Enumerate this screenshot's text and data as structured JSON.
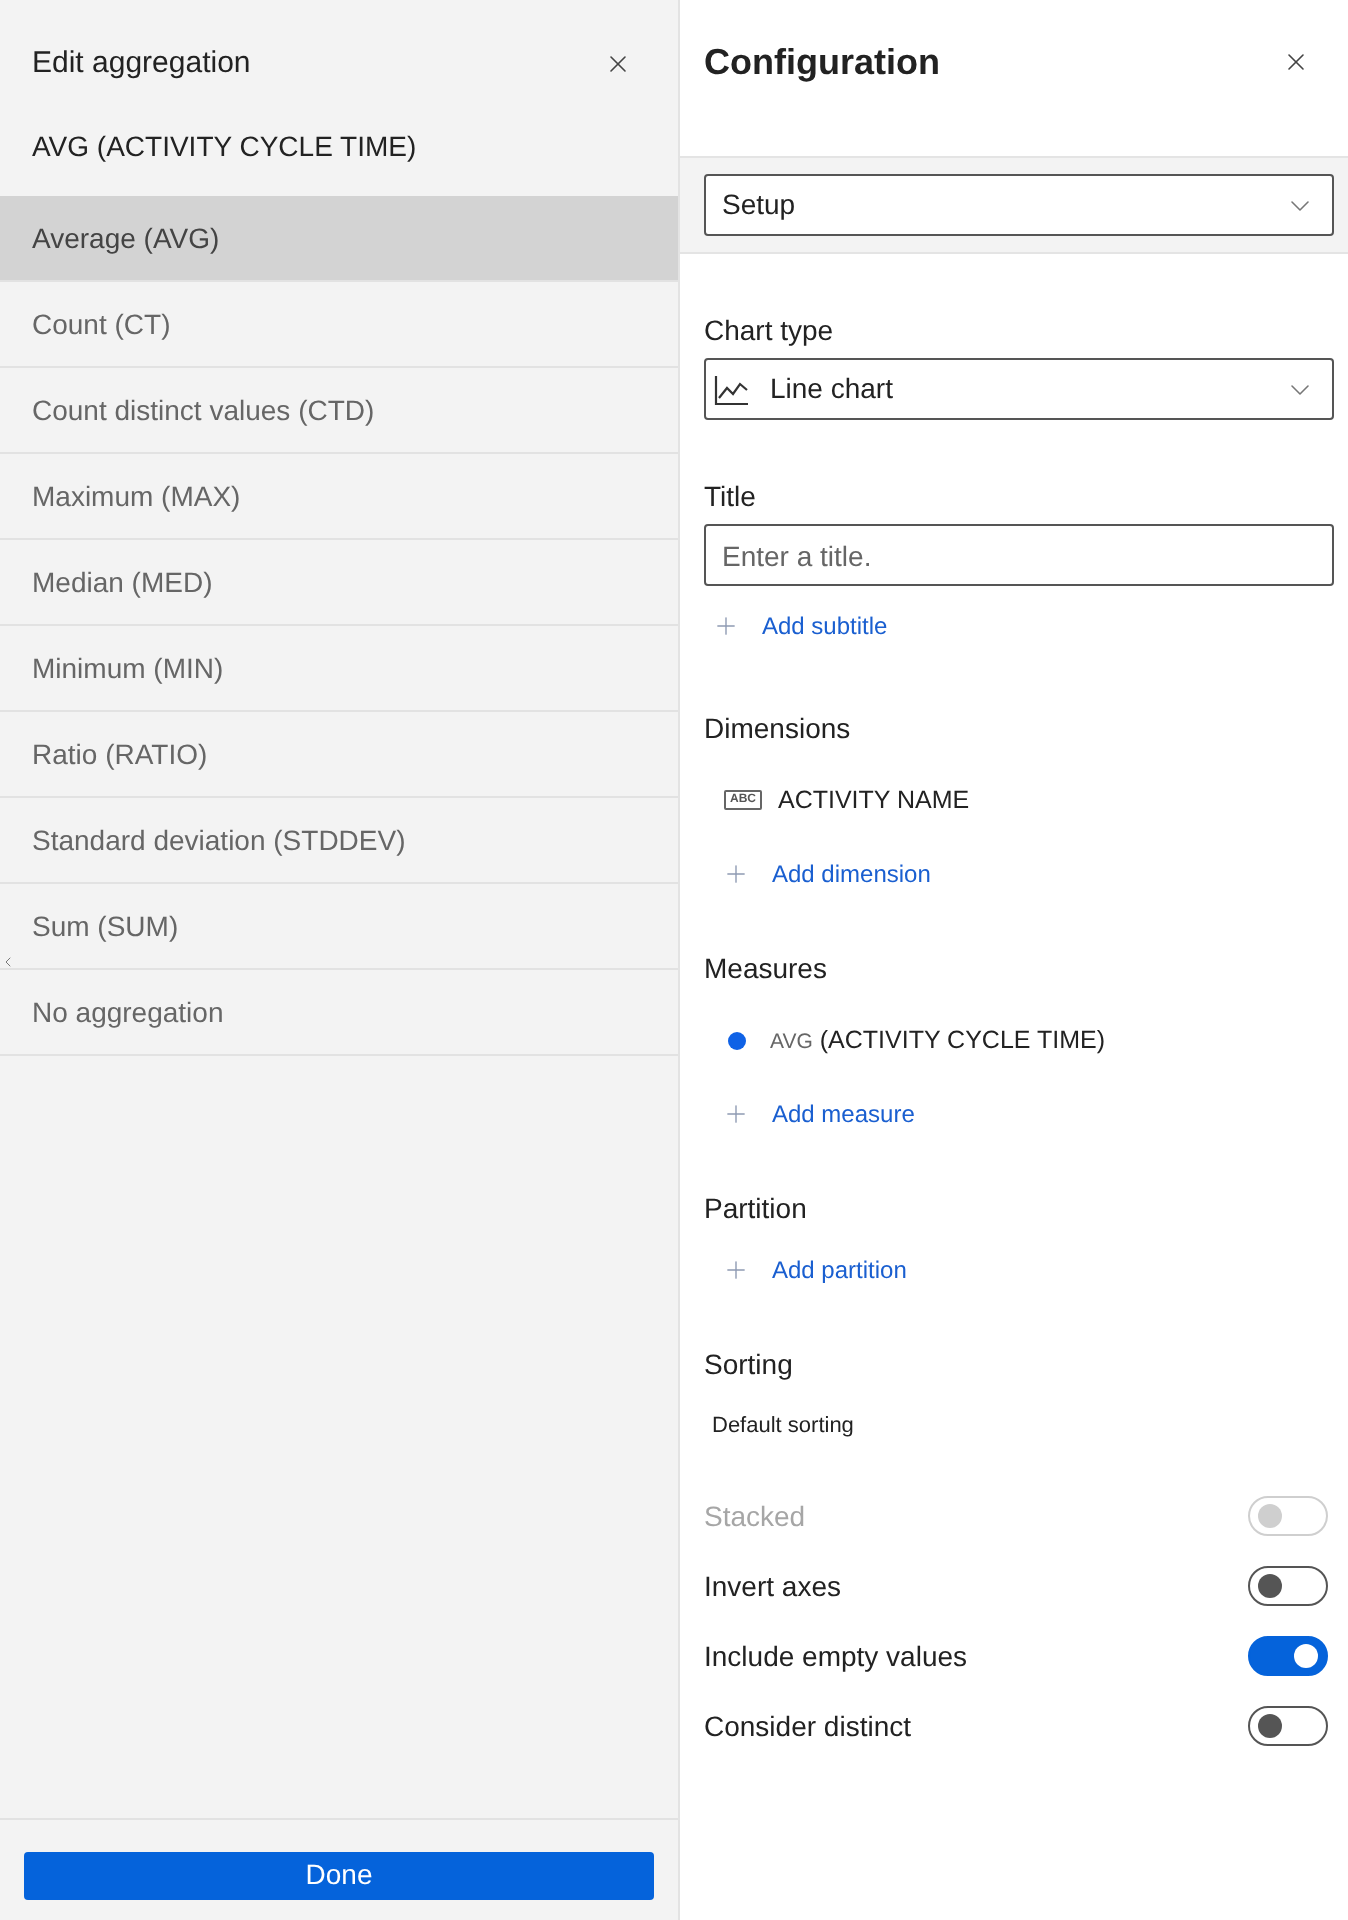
{
  "aggregation_panel": {
    "title": "Edit aggregation",
    "subtitle": "AVG (ACTIVITY CYCLE TIME)",
    "options": [
      {
        "label": "Average (AVG)",
        "selected": true
      },
      {
        "label": "Count (CT)",
        "selected": false
      },
      {
        "label": "Count distinct values (CTD)",
        "selected": false
      },
      {
        "label": "Maximum (MAX)",
        "selected": false
      },
      {
        "label": "Median (MED)",
        "selected": false
      },
      {
        "label": "Minimum (MIN)",
        "selected": false
      },
      {
        "label": "Ratio (RATIO)",
        "selected": false
      },
      {
        "label": "Standard deviation (STDDEV)",
        "selected": false
      },
      {
        "label": "Sum (SUM)",
        "selected": false
      },
      {
        "label": "No aggregation",
        "selected": false
      }
    ],
    "done_button": "Done"
  },
  "configuration_panel": {
    "title": "Configuration",
    "view_select": {
      "value": "Setup"
    },
    "chart_type": {
      "label": "Chart type",
      "value": "Line chart"
    },
    "title_field": {
      "label": "Title",
      "placeholder": "Enter a title.",
      "add_link": "Add subtitle"
    },
    "dimensions": {
      "label": "Dimensions",
      "items": [
        {
          "type_badge": "ABC",
          "name": "ACTIVITY NAME"
        }
      ],
      "add_link": "Add dimension"
    },
    "measures": {
      "label": "Measures",
      "items": [
        {
          "color": "#0f62e6",
          "aggregation": "AVG",
          "field": "(ACTIVITY CYCLE TIME)"
        }
      ],
      "add_link": "Add measure"
    },
    "partition": {
      "label": "Partition",
      "add_link": "Add partition"
    },
    "sorting": {
      "label": "Sorting",
      "value": "Default sorting"
    },
    "toggles": [
      {
        "label": "Stacked",
        "on": false,
        "disabled": true
      },
      {
        "label": "Invert axes",
        "on": false,
        "disabled": false
      },
      {
        "label": "Include empty values",
        "on": true,
        "disabled": false
      },
      {
        "label": "Consider distinct",
        "on": false,
        "disabled": false
      }
    ]
  }
}
